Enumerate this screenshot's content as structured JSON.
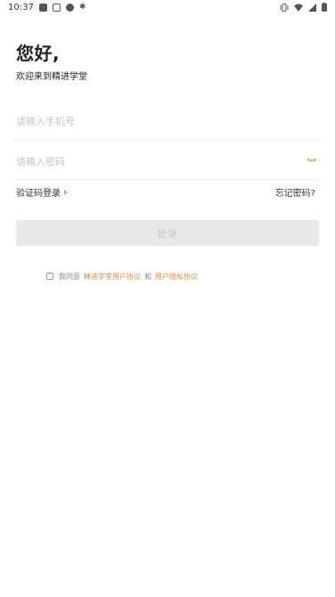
{
  "status_bar": {
    "time": "10:37",
    "icons_left": [
      "app-square-icon",
      "photo-icon",
      "chat-bubble-icon",
      "bug-icon"
    ],
    "icons_right": [
      "vibrate-icon",
      "wifi-icon",
      "signal-icon",
      "battery-icon"
    ]
  },
  "greeting": {
    "title": "您好,",
    "subtitle": "欢迎来到精进学堂"
  },
  "form": {
    "phone_placeholder": "请输入手机号",
    "password_placeholder": "请输入密码",
    "sms_login_label": "验证码登录",
    "forgot_password_label": "忘记密码?",
    "login_label": "登录"
  },
  "agreement": {
    "prefix": "我同意",
    "user_agreement": "精进学堂用户协议",
    "conjunction": "和",
    "privacy_policy": "用户隐私协议"
  },
  "colors": {
    "accent": "#d28b45",
    "button_disabled_bg": "#e8e8e8",
    "placeholder": "#c4c4c4"
  }
}
